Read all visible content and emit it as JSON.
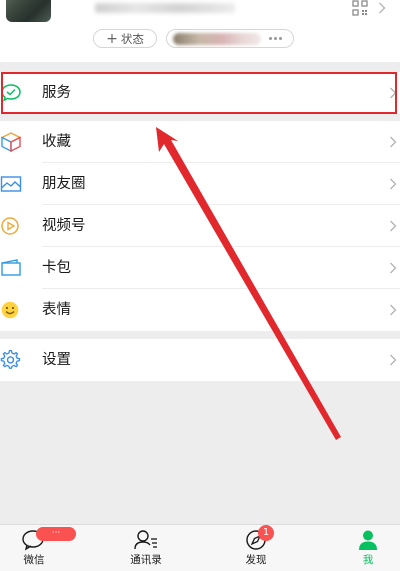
{
  "profile": {
    "status_button_label": "状态",
    "status_plus": "+"
  },
  "menu": {
    "service": "服务",
    "favorites": "收藏",
    "moments": "朋友圈",
    "channels": "视频号",
    "cards": "卡包",
    "stickers": "表情",
    "settings": "设置"
  },
  "tabbar": {
    "chats": "微信",
    "chats_badge": "···",
    "contacts": "通讯录",
    "discover": "发现",
    "discover_badge": "1",
    "me": "我"
  },
  "colors": {
    "accent_green": "#07c160",
    "badge_red": "#fa5151",
    "annotation_red": "#e0282d",
    "background": "#ededed"
  },
  "icons": {
    "service": "chat-bubble-check-icon",
    "favorites": "cube-icon",
    "moments": "landscape-photo-icon",
    "channels": "play-circle-icon",
    "cards": "wallet-card-icon",
    "stickers": "smiley-icon",
    "settings": "gear-icon",
    "profile_qr": "qr-code-icon"
  }
}
